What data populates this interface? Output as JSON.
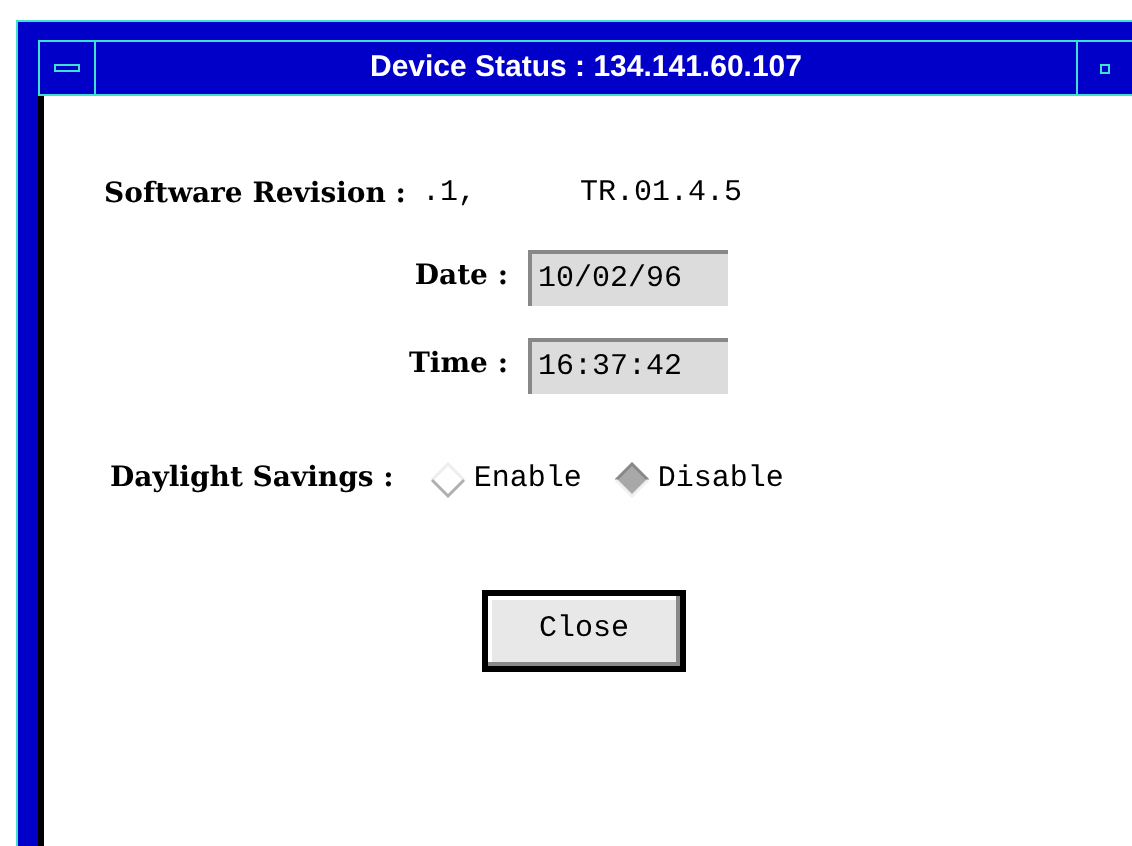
{
  "window": {
    "title": "Device Status : 134.141.60.107"
  },
  "software_revision": {
    "label": "Software Revision :",
    "value_1": ".1,",
    "value_2": "TR.01.4.5"
  },
  "fields": [
    {
      "label": "Date :",
      "value": "10/02/96"
    },
    {
      "label": "Time :",
      "value": "16:37:42"
    }
  ],
  "daylight_savings": {
    "label": "Daylight Savings :",
    "options": [
      {
        "label": "Enable",
        "selected": false
      },
      {
        "label": "Disable",
        "selected": true
      }
    ]
  },
  "buttons": [
    "Close"
  ]
}
